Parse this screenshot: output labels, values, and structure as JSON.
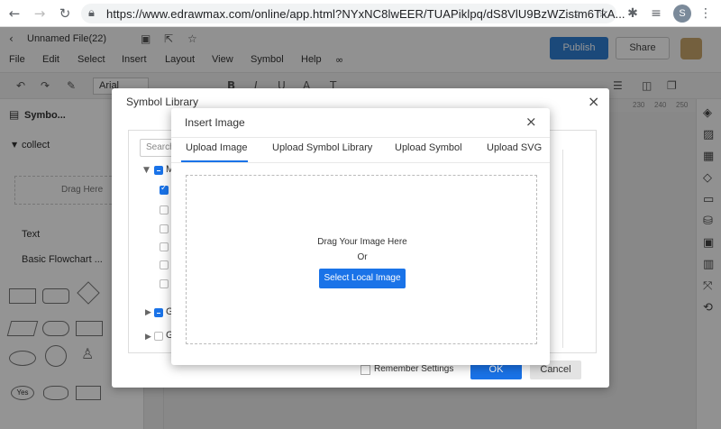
{
  "browser": {
    "url": "https://www.edrawmax.com/online/app.html?NYxNC8lwEER/TUAPiklpq/dS8VlU9BzWZistm6TkA...",
    "profile_initial": "S"
  },
  "app": {
    "file_name": "Unnamed File(22)",
    "menu": [
      "File",
      "Edit",
      "Select",
      "Insert",
      "Layout",
      "View",
      "Symbol",
      "Help"
    ],
    "publish_label": "Publish",
    "share_label": "Share",
    "font_name": "Arial",
    "ruler_ticks": [
      "230",
      "240",
      "250"
    ],
    "left_panel": {
      "title": "Symbo...",
      "collect_label": "collect",
      "drag_here": "Drag Here",
      "text_label": "Text",
      "basic_flowchart": "Basic Flowchart ...",
      "yes_label": "Yes"
    }
  },
  "symbol_library": {
    "title": "Symbol Library",
    "search_placeholder": "Search",
    "tree_letters": [
      "M",
      "G",
      "G"
    ],
    "remember_label": "Remember Settings",
    "ok_label": "OK",
    "cancel_label": "Cancel"
  },
  "insert_image": {
    "title": "Insert Image",
    "tabs": [
      "Upload Image",
      "Upload Symbol Library",
      "Upload Symbol",
      "Upload SVG"
    ],
    "active_tab": "Upload Image",
    "drag_text": "Drag Your Image Here",
    "or_text": "Or",
    "select_button": "Select Local Image"
  },
  "colors": {
    "accent": "#1a73e8",
    "publish": "#2f7fd3"
  }
}
